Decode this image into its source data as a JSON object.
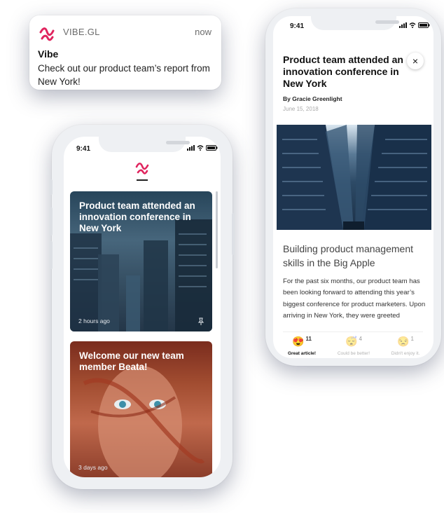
{
  "notification": {
    "app_name": "VIBE.GL",
    "time": "now",
    "title": "Vibe",
    "message": "Check out our product team’s report from New York!"
  },
  "feed_phone": {
    "status_time": "9:41",
    "cards": [
      {
        "title": "Product team attended an innovation conference in New York",
        "meta": "2 hours ago",
        "pinned": true
      },
      {
        "title": "Welcome our new team member Beata!",
        "meta": "3 days ago",
        "pinned": false
      }
    ]
  },
  "article_phone": {
    "status_time": "9:41",
    "title": "Product team attended an innovation conference in New York",
    "close_icon": "×",
    "author": "By Gracie Greenlight",
    "date": "June 15, 2018",
    "subhead": "Building product management skills in the Big Apple",
    "body": "For the past six months, our product team has been looking forward to attending this year’s biggest conference for product marketers. Upon arriving in New York, they were greeted",
    "reactions": [
      {
        "emoji": "😍",
        "count": "11",
        "label": "Great article!"
      },
      {
        "emoji": "😴",
        "count": "4",
        "label": "Could be better!"
      },
      {
        "emoji": "😒",
        "count": "1",
        "label": "Didn't enjoy it."
      }
    ]
  },
  "colors": {
    "brand": "#e0245e",
    "phone_frame": "#eef0f3"
  }
}
